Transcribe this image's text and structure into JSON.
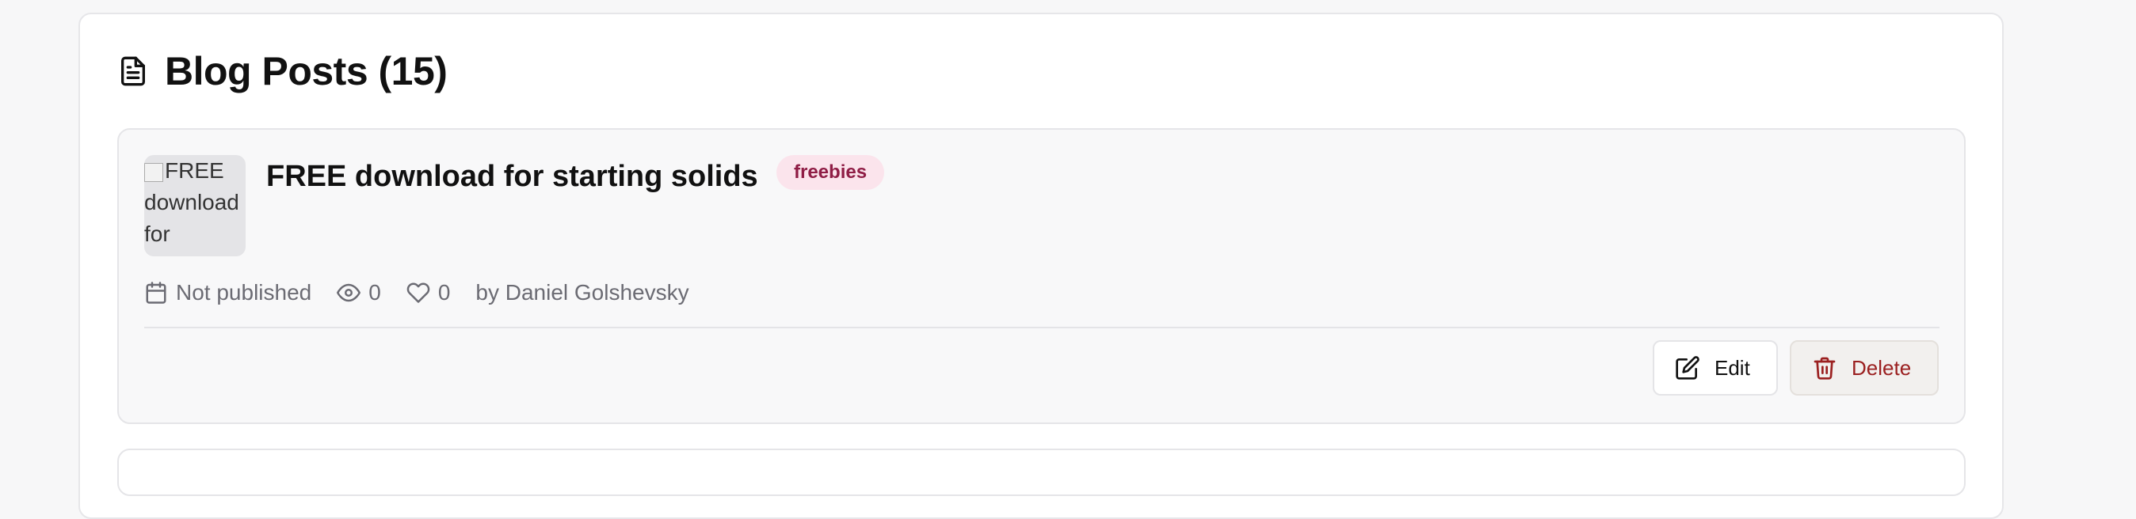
{
  "header": {
    "title": "Blog Posts (15)",
    "icon": "document-icon"
  },
  "posts": [
    {
      "title": "FREE download for starting solids",
      "thumbnail_alt": "FREE download for starting solids",
      "tag": "freebies",
      "status": "Not published",
      "views": "0",
      "likes": "0",
      "author": "by Daniel Golshevsky",
      "actions": {
        "edit": "Edit",
        "delete": "Delete"
      }
    }
  ],
  "colors": {
    "tag_bg": "#fbe4ec",
    "tag_text": "#8f1d45",
    "delete_text": "#9b2020"
  }
}
